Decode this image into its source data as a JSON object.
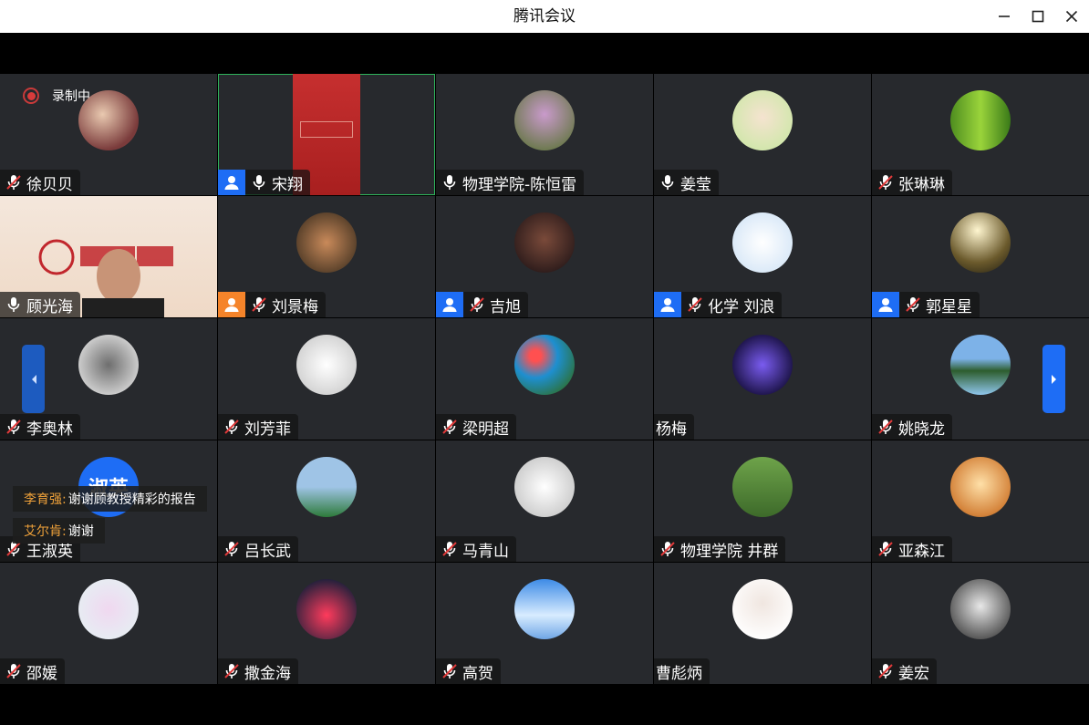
{
  "window": {
    "title": "腾讯会议"
  },
  "recording": {
    "label": "录制中"
  },
  "colors": {
    "host_badge_blue": "#1e6df5",
    "host_badge_orange": "#f5842a",
    "speaking_border": "#2fb35b",
    "chat_sender": "#f0a23a"
  },
  "participants": [
    {
      "name": "徐贝贝",
      "mic": "muted",
      "host": "none"
    },
    {
      "name": "宋翔",
      "mic": "on",
      "host": "blue",
      "active": true
    },
    {
      "name": "物理学院-陈恒雷",
      "mic": "on",
      "host": "none"
    },
    {
      "name": "姜莹",
      "mic": "on",
      "host": "none"
    },
    {
      "name": "张琳琳",
      "mic": "muted",
      "host": "none"
    },
    {
      "name": "顾光海",
      "mic": "on",
      "host": "none",
      "video": true
    },
    {
      "name": "刘景梅",
      "mic": "muted",
      "host": "orange"
    },
    {
      "name": "吉旭",
      "mic": "muted",
      "host": "blue"
    },
    {
      "name": "化学 刘浪",
      "mic": "muted",
      "host": "blue"
    },
    {
      "name": "郭星星",
      "mic": "muted",
      "host": "blue"
    },
    {
      "name": "李奥林",
      "mic": "muted",
      "host": "none"
    },
    {
      "name": "刘芳菲",
      "mic": "muted",
      "host": "none"
    },
    {
      "name": "梁明超",
      "mic": "muted",
      "host": "none"
    },
    {
      "name": "杨梅",
      "mic": "none",
      "host": "none"
    },
    {
      "name": "姚晓龙",
      "mic": "muted",
      "host": "none"
    },
    {
      "name": "王淑英",
      "mic": "muted",
      "host": "none",
      "avatar_text": "淑英"
    },
    {
      "name": "吕长武",
      "mic": "muted",
      "host": "none"
    },
    {
      "name": "马青山",
      "mic": "muted",
      "host": "none"
    },
    {
      "name": "物理学院 井群",
      "mic": "muted",
      "host": "none"
    },
    {
      "name": "亚森江",
      "mic": "muted",
      "host": "none"
    },
    {
      "name": "邵媛",
      "mic": "muted",
      "host": "none"
    },
    {
      "name": "撒金海",
      "mic": "muted",
      "host": "none"
    },
    {
      "name": "高贺",
      "mic": "muted",
      "host": "none"
    },
    {
      "name": "曹彪炳",
      "mic": "none",
      "host": "none"
    },
    {
      "name": "姜宏",
      "mic": "muted",
      "host": "none"
    }
  ],
  "chat": [
    {
      "sender": "李育强:",
      "message": "谢谢顾教授精彩的报告"
    },
    {
      "sender": "艾尔肯:",
      "message": "谢谢"
    }
  ]
}
